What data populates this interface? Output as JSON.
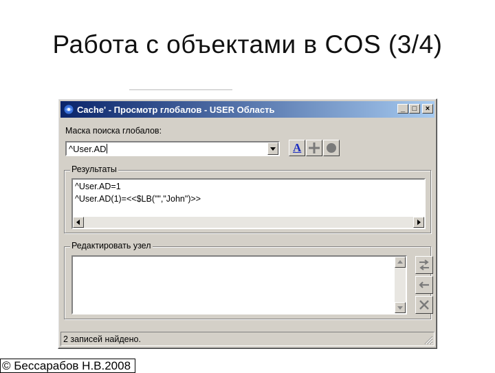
{
  "slide": {
    "title": "Работа с объектами в COS (3/4)",
    "footer": "© Бессарабов Н.В.2008"
  },
  "window": {
    "title": "Cache' - Просмотр глобалов - USER Область",
    "controls": {
      "minimize": "_",
      "maximize": "□",
      "close": "×"
    }
  },
  "search": {
    "label": "Маска поиска глобалов:",
    "value": "^User.AD"
  },
  "toolbar": {
    "font_button": "A"
  },
  "results": {
    "legend": "Результаты",
    "lines": [
      "^User.AD=1",
      "^User.AD(1)=<<$LB(\"\",\"John\")>>"
    ]
  },
  "edit": {
    "legend": "Редактировать узел",
    "value": ""
  },
  "status": {
    "text": "2 записей найдено."
  },
  "colors": {
    "titlebar_start": "#0a246a",
    "titlebar_end": "#a6caf0",
    "face": "#d4d0c8"
  }
}
